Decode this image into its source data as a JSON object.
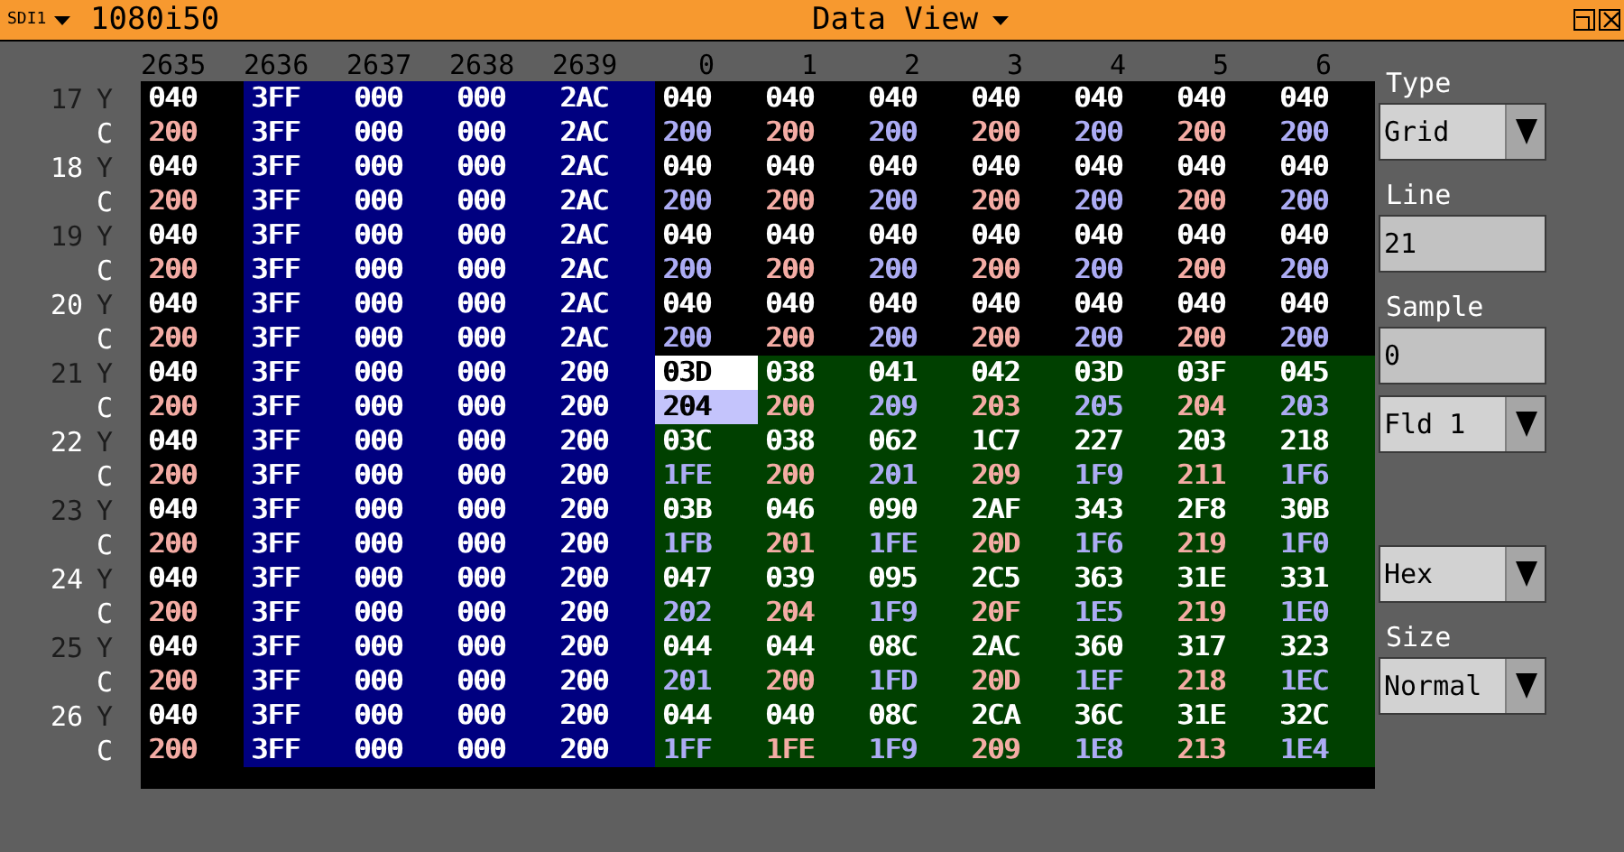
{
  "title_bar": {
    "source": "SDI1",
    "format": "1080i50",
    "view": "Data View"
  },
  "columns": [
    {
      "label": "2635",
      "kind": "blank",
      "selected": false
    },
    {
      "label": "2636",
      "kind": "trs",
      "selected": false
    },
    {
      "label": "2637",
      "kind": "trs",
      "selected": false
    },
    {
      "label": "2638",
      "kind": "trs",
      "selected": false
    },
    {
      "label": "2639",
      "kind": "trs",
      "selected": false
    },
    {
      "label": "0",
      "kind": "active",
      "selected": true
    },
    {
      "label": "1",
      "kind": "active",
      "selected": false
    },
    {
      "label": "2",
      "kind": "active",
      "selected": false
    },
    {
      "label": "3",
      "kind": "active",
      "selected": false
    },
    {
      "label": "4",
      "kind": "active",
      "selected": false
    },
    {
      "label": "5",
      "kind": "active",
      "selected": false
    },
    {
      "label": "6",
      "kind": "active",
      "selected": false
    }
  ],
  "rows": [
    {
      "line": {
        "text": "17",
        "color": "#1c1c1c"
      },
      "component": {
        "text": "Y",
        "color": "#1c1c1c"
      },
      "picture": false,
      "selected": false,
      "cells": [
        "040",
        "3FF",
        "000",
        "000",
        "2AC",
        "040",
        "040",
        "040",
        "040",
        "040",
        "040",
        "040"
      ]
    },
    {
      "component": {
        "text": "C",
        "color": "#ffffff"
      },
      "picture": false,
      "selected": false,
      "cells": [
        {
          "text": "200",
          "color": "#f4aca4"
        },
        {
          "text": "3FF",
          "color": "#ffffff"
        },
        {
          "text": "000",
          "color": "#ffffff"
        },
        {
          "text": "000",
          "color": "#ffffff"
        },
        {
          "text": "2AC",
          "color": "#ffffff"
        },
        {
          "text": "200",
          "color": "#acacf4"
        },
        {
          "text": "200",
          "color": "#f4aca4"
        },
        {
          "text": "200",
          "color": "#acacf4"
        },
        {
          "text": "200",
          "color": "#f4aca4"
        },
        {
          "text": "200",
          "color": "#acacf4"
        },
        {
          "text": "200",
          "color": "#f4aca4"
        },
        {
          "text": "200",
          "color": "#acacf4"
        }
      ]
    },
    {
      "line": {
        "text": "18",
        "color": "#ffffff"
      },
      "component": {
        "text": "Y",
        "color": "#1c1c1c"
      },
      "picture": false,
      "selected": false,
      "cells": [
        "040",
        "3FF",
        "000",
        "000",
        "2AC",
        "040",
        "040",
        "040",
        "040",
        "040",
        "040",
        "040"
      ]
    },
    {
      "component": {
        "text": "C",
        "color": "#ffffff"
      },
      "picture": false,
      "selected": false,
      "cells": [
        {
          "text": "200",
          "color": "#f4aca4"
        },
        {
          "text": "3FF",
          "color": "#ffffff"
        },
        {
          "text": "000",
          "color": "#ffffff"
        },
        {
          "text": "000",
          "color": "#ffffff"
        },
        {
          "text": "2AC",
          "color": "#ffffff"
        },
        {
          "text": "200",
          "color": "#acacf4"
        },
        {
          "text": "200",
          "color": "#f4aca4"
        },
        {
          "text": "200",
          "color": "#acacf4"
        },
        {
          "text": "200",
          "color": "#f4aca4"
        },
        {
          "text": "200",
          "color": "#acacf4"
        },
        {
          "text": "200",
          "color": "#f4aca4"
        },
        {
          "text": "200",
          "color": "#acacf4"
        }
      ]
    },
    {
      "line": {
        "text": "19",
        "color": "#1c1c1c"
      },
      "component": {
        "text": "Y",
        "color": "#1c1c1c"
      },
      "picture": false,
      "selected": false,
      "cells": [
        "040",
        "3FF",
        "000",
        "000",
        "2AC",
        "040",
        "040",
        "040",
        "040",
        "040",
        "040",
        "040"
      ]
    },
    {
      "component": {
        "text": "C",
        "color": "#ffffff"
      },
      "picture": false,
      "selected": false,
      "cells": [
        {
          "text": "200",
          "color": "#f4aca4"
        },
        {
          "text": "3FF",
          "color": "#ffffff"
        },
        {
          "text": "000",
          "color": "#ffffff"
        },
        {
          "text": "000",
          "color": "#ffffff"
        },
        {
          "text": "2AC",
          "color": "#ffffff"
        },
        {
          "text": "200",
          "color": "#acacf4"
        },
        {
          "text": "200",
          "color": "#f4aca4"
        },
        {
          "text": "200",
          "color": "#acacf4"
        },
        {
          "text": "200",
          "color": "#f4aca4"
        },
        {
          "text": "200",
          "color": "#acacf4"
        },
        {
          "text": "200",
          "color": "#f4aca4"
        },
        {
          "text": "200",
          "color": "#acacf4"
        }
      ]
    },
    {
      "line": {
        "text": "20",
        "color": "#ffffff"
      },
      "component": {
        "text": "Y",
        "color": "#1c1c1c"
      },
      "picture": false,
      "selected": false,
      "cells": [
        "040",
        "3FF",
        "000",
        "000",
        "2AC",
        "040",
        "040",
        "040",
        "040",
        "040",
        "040",
        "040"
      ]
    },
    {
      "component": {
        "text": "C",
        "color": "#ffffff"
      },
      "picture": false,
      "selected": false,
      "cells": [
        {
          "text": "200",
          "color": "#f4aca4"
        },
        {
          "text": "3FF",
          "color": "#ffffff"
        },
        {
          "text": "000",
          "color": "#ffffff"
        },
        {
          "text": "000",
          "color": "#ffffff"
        },
        {
          "text": "2AC",
          "color": "#ffffff"
        },
        {
          "text": "200",
          "color": "#acacf4"
        },
        {
          "text": "200",
          "color": "#f4aca4"
        },
        {
          "text": "200",
          "color": "#acacf4"
        },
        {
          "text": "200",
          "color": "#f4aca4"
        },
        {
          "text": "200",
          "color": "#acacf4"
        },
        {
          "text": "200",
          "color": "#f4aca4"
        },
        {
          "text": "200",
          "color": "#acacf4"
        }
      ]
    },
    {
      "line": {
        "text": "21",
        "color": "#1c1c1c"
      },
      "component": {
        "text": "Y",
        "color": "#1c1c1c"
      },
      "picture": true,
      "selected": true,
      "cells": [
        "040",
        "3FF",
        "000",
        "000",
        "200",
        "03D",
        "038",
        "041",
        "042",
        "03D",
        "03F",
        "045"
      ]
    },
    {
      "component": {
        "text": "C",
        "color": "#ffffff"
      },
      "picture": true,
      "selected": true,
      "cells": [
        {
          "text": "200",
          "color": "#f4aca4"
        },
        {
          "text": "3FF",
          "color": "#ffffff"
        },
        {
          "text": "000",
          "color": "#ffffff"
        },
        {
          "text": "000",
          "color": "#ffffff"
        },
        {
          "text": "200",
          "color": "#ffffff"
        },
        {
          "text": "204",
          "color": "#c4c4fc"
        },
        {
          "text": "200",
          "color": "#f4aca4"
        },
        {
          "text": "209",
          "color": "#acacf4"
        },
        {
          "text": "203",
          "color": "#f4aca4"
        },
        {
          "text": "205",
          "color": "#acacf4"
        },
        {
          "text": "204",
          "color": "#f4aca4"
        },
        {
          "text": "203",
          "color": "#acacf4"
        }
      ]
    },
    {
      "line": {
        "text": "22",
        "color": "#ffffff"
      },
      "component": {
        "text": "Y",
        "color": "#1c1c1c"
      },
      "picture": true,
      "selected": false,
      "cells": [
        "040",
        "3FF",
        "000",
        "000",
        "200",
        "03C",
        "038",
        "062",
        "1C7",
        "227",
        "203",
        "218"
      ]
    },
    {
      "component": {
        "text": "C",
        "color": "#ffffff"
      },
      "picture": true,
      "selected": false,
      "cells": [
        {
          "text": "200",
          "color": "#f4aca4"
        },
        {
          "text": "3FF",
          "color": "#ffffff"
        },
        {
          "text": "000",
          "color": "#ffffff"
        },
        {
          "text": "000",
          "color": "#ffffff"
        },
        {
          "text": "200",
          "color": "#ffffff"
        },
        {
          "text": "1FE",
          "color": "#acacf4"
        },
        {
          "text": "200",
          "color": "#f4aca4"
        },
        {
          "text": "201",
          "color": "#acacf4"
        },
        {
          "text": "209",
          "color": "#f4aca4"
        },
        {
          "text": "1F9",
          "color": "#acacf4"
        },
        {
          "text": "211",
          "color": "#f4aca4"
        },
        {
          "text": "1F6",
          "color": "#acacf4"
        }
      ]
    },
    {
      "line": {
        "text": "23",
        "color": "#1c1c1c"
      },
      "component": {
        "text": "Y",
        "color": "#1c1c1c"
      },
      "picture": true,
      "selected": false,
      "cells": [
        "040",
        "3FF",
        "000",
        "000",
        "200",
        "03B",
        "046",
        "090",
        "2AF",
        "343",
        "2F8",
        "30B"
      ]
    },
    {
      "component": {
        "text": "C",
        "color": "#ffffff"
      },
      "picture": true,
      "selected": false,
      "cells": [
        {
          "text": "200",
          "color": "#f4aca4"
        },
        {
          "text": "3FF",
          "color": "#ffffff"
        },
        {
          "text": "000",
          "color": "#ffffff"
        },
        {
          "text": "000",
          "color": "#ffffff"
        },
        {
          "text": "200",
          "color": "#ffffff"
        },
        {
          "text": "1FB",
          "color": "#acacf4"
        },
        {
          "text": "201",
          "color": "#f4aca4"
        },
        {
          "text": "1FE",
          "color": "#acacf4"
        },
        {
          "text": "20D",
          "color": "#f4aca4"
        },
        {
          "text": "1F6",
          "color": "#acacf4"
        },
        {
          "text": "219",
          "color": "#f4aca4"
        },
        {
          "text": "1F0",
          "color": "#acacf4"
        }
      ]
    },
    {
      "line": {
        "text": "24",
        "color": "#ffffff"
      },
      "component": {
        "text": "Y",
        "color": "#1c1c1c"
      },
      "picture": true,
      "selected": false,
      "cells": [
        "040",
        "3FF",
        "000",
        "000",
        "200",
        "047",
        "039",
        "095",
        "2C5",
        "363",
        "31E",
        "331"
      ]
    },
    {
      "component": {
        "text": "C",
        "color": "#ffffff"
      },
      "picture": true,
      "selected": false,
      "cells": [
        {
          "text": "200",
          "color": "#f4aca4"
        },
        {
          "text": "3FF",
          "color": "#ffffff"
        },
        {
          "text": "000",
          "color": "#ffffff"
        },
        {
          "text": "000",
          "color": "#ffffff"
        },
        {
          "text": "200",
          "color": "#ffffff"
        },
        {
          "text": "202",
          "color": "#acacf4"
        },
        {
          "text": "204",
          "color": "#f4aca4"
        },
        {
          "text": "1F9",
          "color": "#acacf4"
        },
        {
          "text": "20F",
          "color": "#f4aca4"
        },
        {
          "text": "1E5",
          "color": "#acacf4"
        },
        {
          "text": "219",
          "color": "#f4aca4"
        },
        {
          "text": "1E0",
          "color": "#acacf4"
        }
      ]
    },
    {
      "line": {
        "text": "25",
        "color": "#1c1c1c"
      },
      "component": {
        "text": "Y",
        "color": "#1c1c1c"
      },
      "picture": true,
      "selected": false,
      "cells": [
        "040",
        "3FF",
        "000",
        "000",
        "200",
        "044",
        "044",
        "08C",
        "2AC",
        "360",
        "317",
        "323"
      ]
    },
    {
      "component": {
        "text": "C",
        "color": "#ffffff"
      },
      "picture": true,
      "selected": false,
      "cells": [
        {
          "text": "200",
          "color": "#f4aca4"
        },
        {
          "text": "3FF",
          "color": "#ffffff"
        },
        {
          "text": "000",
          "color": "#ffffff"
        },
        {
          "text": "000",
          "color": "#ffffff"
        },
        {
          "text": "200",
          "color": "#ffffff"
        },
        {
          "text": "201",
          "color": "#acacf4"
        },
        {
          "text": "200",
          "color": "#f4aca4"
        },
        {
          "text": "1FD",
          "color": "#acacf4"
        },
        {
          "text": "20D",
          "color": "#f4aca4"
        },
        {
          "text": "1EF",
          "color": "#acacf4"
        },
        {
          "text": "218",
          "color": "#f4aca4"
        },
        {
          "text": "1EC",
          "color": "#acacf4"
        }
      ]
    },
    {
      "line": {
        "text": "26",
        "color": "#ffffff"
      },
      "component": {
        "text": "Y",
        "color": "#1c1c1c"
      },
      "picture": true,
      "selected": false,
      "cells": [
        "040",
        "3FF",
        "000",
        "000",
        "200",
        "044",
        "040",
        "08C",
        "2CA",
        "36C",
        "31E",
        "32C"
      ]
    },
    {
      "component": {
        "text": "C",
        "color": "#ffffff"
      },
      "picture": true,
      "selected": false,
      "cells": [
        {
          "text": "200",
          "color": "#f4aca4"
        },
        {
          "text": "3FF",
          "color": "#ffffff"
        },
        {
          "text": "000",
          "color": "#ffffff"
        },
        {
          "text": "000",
          "color": "#ffffff"
        },
        {
          "text": "200",
          "color": "#ffffff"
        },
        {
          "text": "1FF",
          "color": "#acacf4"
        },
        {
          "text": "1FE",
          "color": "#f4aca4"
        },
        {
          "text": "1F9",
          "color": "#acacf4"
        },
        {
          "text": "209",
          "color": "#f4aca4"
        },
        {
          "text": "1E8",
          "color": "#acacf4"
        },
        {
          "text": "213",
          "color": "#f4aca4"
        },
        {
          "text": "1E4",
          "color": "#acacf4"
        }
      ]
    }
  ],
  "panel": [
    {
      "kind": "dropdown",
      "label": "Type",
      "value": "Grid"
    },
    {
      "kind": "field",
      "label": "Line",
      "value": "21"
    },
    {
      "kind": "field",
      "label": "Sample",
      "value": "0"
    },
    {
      "kind": "dropdown",
      "value": "Fld 1"
    },
    {
      "kind": "dropdown",
      "value": "Hex"
    },
    {
      "kind": "dropdown",
      "label": "Size",
      "value": "Normal"
    }
  ]
}
